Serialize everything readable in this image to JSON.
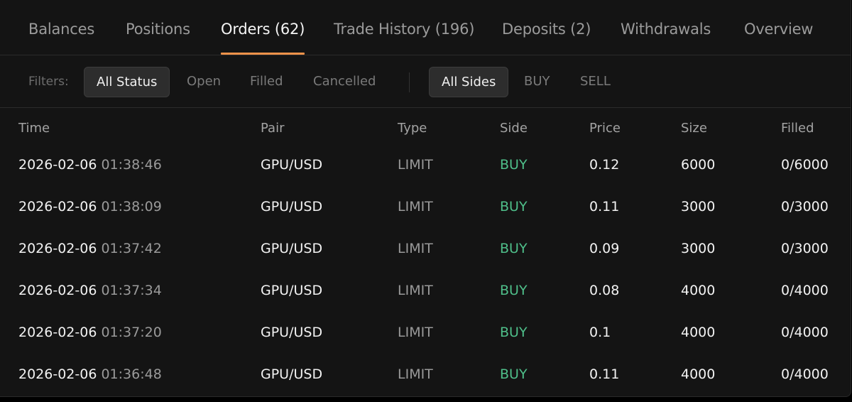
{
  "tabs": [
    {
      "label": "Balances"
    },
    {
      "label": "Positions"
    },
    {
      "label": "Orders (62)"
    },
    {
      "label": "Trade History (196)"
    },
    {
      "label": "Deposits (2)"
    },
    {
      "label": "Withdrawals"
    },
    {
      "label": "Overview"
    }
  ],
  "active_tab": "Orders (62)",
  "accent_color": "#f0924a",
  "buy_color": "#4fbf8a",
  "filters": {
    "label": "Filters:",
    "status": [
      "All Status",
      "Open",
      "Filled",
      "Cancelled"
    ],
    "status_selected": "All Status",
    "sides": [
      "All Sides",
      "BUY",
      "SELL"
    ],
    "sides_selected": "All Sides"
  },
  "columns": [
    "Time",
    "Pair",
    "Type",
    "Side",
    "Price",
    "Size",
    "Filled"
  ],
  "rows": [
    {
      "date": "2026-02-06",
      "time": "01:38:46",
      "pair": "GPU/USD",
      "type": "LIMIT",
      "side": "BUY",
      "price": "0.12",
      "size": "6000",
      "filled": "0/6000"
    },
    {
      "date": "2026-02-06",
      "time": "01:38:09",
      "pair": "GPU/USD",
      "type": "LIMIT",
      "side": "BUY",
      "price": "0.11",
      "size": "3000",
      "filled": "0/3000"
    },
    {
      "date": "2026-02-06",
      "time": "01:37:42",
      "pair": "GPU/USD",
      "type": "LIMIT",
      "side": "BUY",
      "price": "0.09",
      "size": "3000",
      "filled": "0/3000"
    },
    {
      "date": "2026-02-06",
      "time": "01:37:34",
      "pair": "GPU/USD",
      "type": "LIMIT",
      "side": "BUY",
      "price": "0.08",
      "size": "4000",
      "filled": "0/4000"
    },
    {
      "date": "2026-02-06",
      "time": "01:37:20",
      "pair": "GPU/USD",
      "type": "LIMIT",
      "side": "BUY",
      "price": "0.1",
      "size": "4000",
      "filled": "0/4000"
    },
    {
      "date": "2026-02-06",
      "time": "01:36:48",
      "pair": "GPU/USD",
      "type": "LIMIT",
      "side": "BUY",
      "price": "0.11",
      "size": "4000",
      "filled": "0/4000"
    }
  ]
}
